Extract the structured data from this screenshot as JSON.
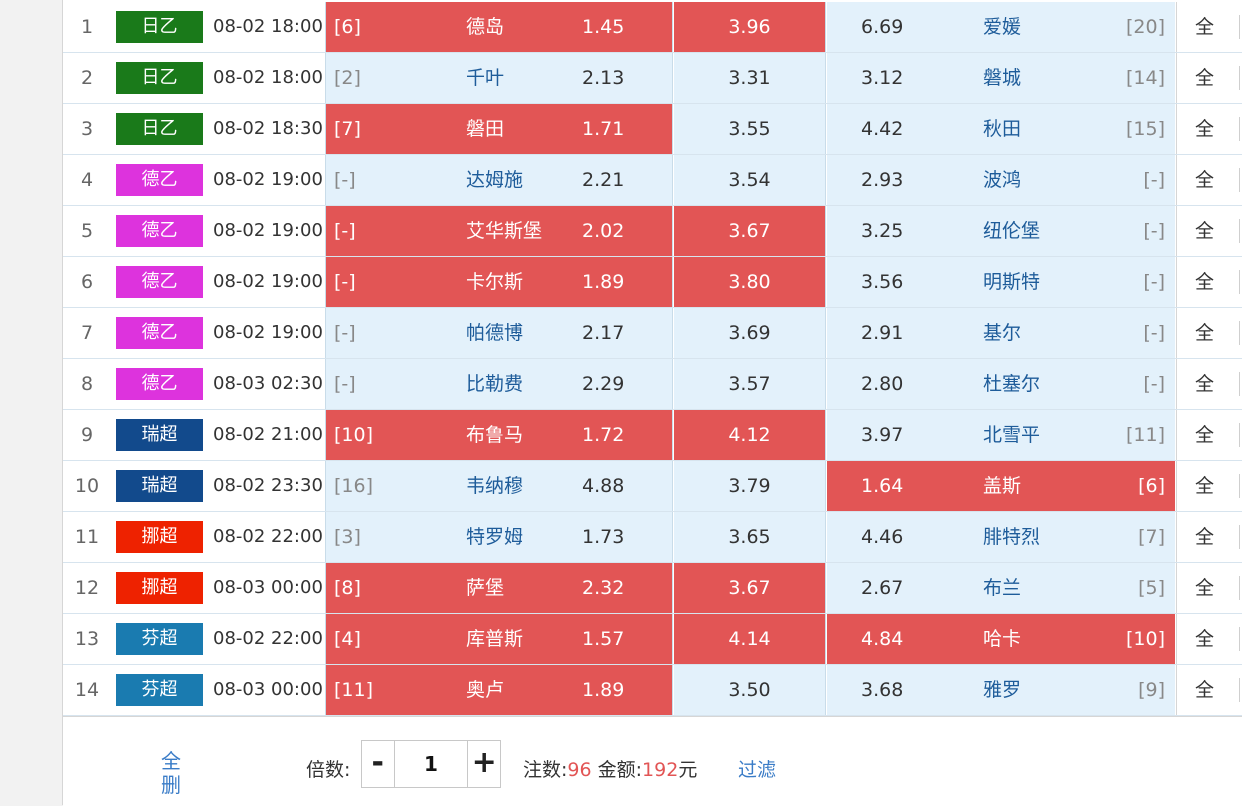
{
  "colors": {
    "selected": "#e25555",
    "odds_bg": "#e3f1fb",
    "league_j2": "#1a7a1a",
    "league_bundesliga2": "#dd33dd",
    "league_swiss": "#124a8c",
    "league_norway": "#ee2200",
    "league_finland": "#1a7bb0"
  },
  "matches": [
    {
      "no": "1",
      "league": "日乙",
      "league_color": "#1a7a1a",
      "time": "08-02 18:00",
      "home_rank": "[6]",
      "home": "德岛",
      "home_odds": "1.45",
      "draw_odds": "3.96",
      "away_odds": "6.69",
      "away": "爱媛",
      "away_rank": "[20]",
      "all": "全",
      "sel": [
        true,
        true,
        false
      ]
    },
    {
      "no": "2",
      "league": "日乙",
      "league_color": "#1a7a1a",
      "time": "08-02 18:00",
      "home_rank": "[2]",
      "home": "千叶",
      "home_odds": "2.13",
      "draw_odds": "3.31",
      "away_odds": "3.12",
      "away": "磐城",
      "away_rank": "[14]",
      "all": "全",
      "sel": [
        false,
        false,
        false
      ]
    },
    {
      "no": "3",
      "league": "日乙",
      "league_color": "#1a7a1a",
      "time": "08-02 18:30",
      "home_rank": "[7]",
      "home": "磐田",
      "home_odds": "1.71",
      "draw_odds": "3.55",
      "away_odds": "4.42",
      "away": "秋田",
      "away_rank": "[15]",
      "all": "全",
      "sel": [
        true,
        false,
        false
      ]
    },
    {
      "no": "4",
      "league": "德乙",
      "league_color": "#dd33dd",
      "time": "08-02 19:00",
      "home_rank": "[-]",
      "home": "达姆施",
      "home_odds": "2.21",
      "draw_odds": "3.54",
      "away_odds": "2.93",
      "away": "波鸿",
      "away_rank": "[-]",
      "all": "全",
      "sel": [
        false,
        false,
        false
      ]
    },
    {
      "no": "5",
      "league": "德乙",
      "league_color": "#dd33dd",
      "time": "08-02 19:00",
      "home_rank": "[-]",
      "home": "艾华斯堡",
      "home_odds": "2.02",
      "draw_odds": "3.67",
      "away_odds": "3.25",
      "away": "纽伦堡",
      "away_rank": "[-]",
      "all": "全",
      "sel": [
        true,
        true,
        false
      ]
    },
    {
      "no": "6",
      "league": "德乙",
      "league_color": "#dd33dd",
      "time": "08-02 19:00",
      "home_rank": "[-]",
      "home": "卡尔斯",
      "home_odds": "1.89",
      "draw_odds": "3.80",
      "away_odds": "3.56",
      "away": "明斯特",
      "away_rank": "[-]",
      "all": "全",
      "sel": [
        true,
        true,
        false
      ]
    },
    {
      "no": "7",
      "league": "德乙",
      "league_color": "#dd33dd",
      "time": "08-02 19:00",
      "home_rank": "[-]",
      "home": "帕德博",
      "home_odds": "2.17",
      "draw_odds": "3.69",
      "away_odds": "2.91",
      "away": "基尔",
      "away_rank": "[-]",
      "all": "全",
      "sel": [
        false,
        false,
        false
      ]
    },
    {
      "no": "8",
      "league": "德乙",
      "league_color": "#dd33dd",
      "time": "08-03 02:30",
      "home_rank": "[-]",
      "home": "比勒费",
      "home_odds": "2.29",
      "draw_odds": "3.57",
      "away_odds": "2.80",
      "away": "杜塞尔",
      "away_rank": "[-]",
      "all": "全",
      "sel": [
        false,
        false,
        false
      ]
    },
    {
      "no": "9",
      "league": "瑞超",
      "league_color": "#124a8c",
      "time": "08-02 21:00",
      "home_rank": "[10]",
      "home": "布鲁马",
      "home_odds": "1.72",
      "draw_odds": "4.12",
      "away_odds": "3.97",
      "away": "北雪平",
      "away_rank": "[11]",
      "all": "全",
      "sel": [
        true,
        true,
        false
      ]
    },
    {
      "no": "10",
      "league": "瑞超",
      "league_color": "#124a8c",
      "time": "08-02 23:30",
      "home_rank": "[16]",
      "home": "韦纳穆",
      "home_odds": "4.88",
      "draw_odds": "3.79",
      "away_odds": "1.64",
      "away": "盖斯",
      "away_rank": "[6]",
      "all": "全",
      "sel": [
        false,
        false,
        true
      ]
    },
    {
      "no": "11",
      "league": "挪超",
      "league_color": "#ee2200",
      "time": "08-02 22:00",
      "home_rank": "[3]",
      "home": "特罗姆",
      "home_odds": "1.73",
      "draw_odds": "3.65",
      "away_odds": "4.46",
      "away": "腓特烈",
      "away_rank": "[7]",
      "all": "全",
      "sel": [
        false,
        false,
        false
      ]
    },
    {
      "no": "12",
      "league": "挪超",
      "league_color": "#ee2200",
      "time": "08-03 00:00",
      "home_rank": "[8]",
      "home": "萨堡",
      "home_odds": "2.32",
      "draw_odds": "3.67",
      "away_odds": "2.67",
      "away": "布兰",
      "away_rank": "[5]",
      "all": "全",
      "sel": [
        true,
        true,
        false
      ]
    },
    {
      "no": "13",
      "league": "芬超",
      "league_color": "#1a7bb0",
      "time": "08-02 22:00",
      "home_rank": "[4]",
      "home": "库普斯",
      "home_odds": "1.57",
      "draw_odds": "4.14",
      "away_odds": "4.84",
      "away": "哈卡",
      "away_rank": "[10]",
      "all": "全",
      "sel": [
        true,
        true,
        true
      ]
    },
    {
      "no": "14",
      "league": "芬超",
      "league_color": "#1a7bb0",
      "time": "08-03 00:00",
      "home_rank": "[11]",
      "home": "奥卢",
      "home_odds": "1.89",
      "draw_odds": "3.50",
      "away_odds": "3.68",
      "away": "雅罗",
      "away_rank": "[9]",
      "all": "全",
      "sel": [
        true,
        false,
        false
      ]
    }
  ],
  "footer": {
    "delete_all": "全删",
    "multiplier_label": "倍数:",
    "minus": "-",
    "multiplier_value": "1",
    "plus": "+",
    "bets_label": "注数:",
    "bets_value": "96",
    "amount_label": "金额:",
    "amount_value": "192",
    "amount_unit": "元",
    "filter": "过滤"
  }
}
